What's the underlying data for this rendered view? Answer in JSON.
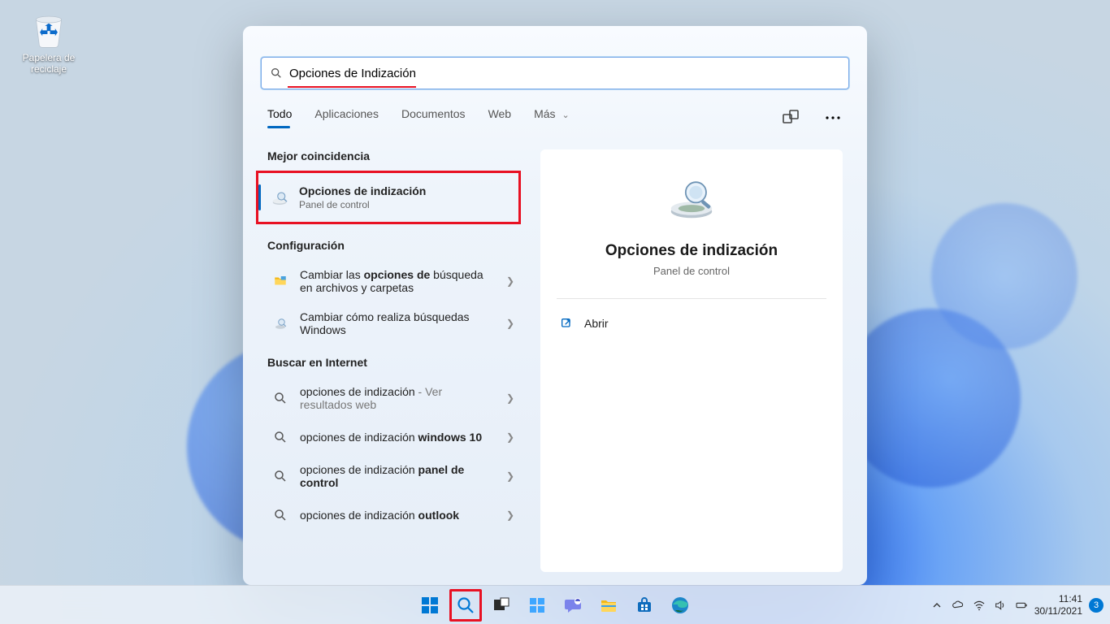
{
  "desktop": {
    "recycle_bin": "Papelera de reciclaje"
  },
  "search": {
    "query": "Opciones de Indización",
    "tabs": {
      "all": "Todo",
      "apps": "Aplicaciones",
      "docs": "Documentos",
      "web": "Web",
      "more": "Más"
    },
    "best_match_label": "Mejor coincidencia",
    "best_match": {
      "title": "Opciones de indización",
      "subtitle": "Panel de control"
    },
    "settings_label": "Configuración",
    "settings_items": [
      {
        "html": "Cambiar las <strong>opciones de</strong> búsqueda en archivos y carpetas"
      },
      {
        "html": "Cambiar cómo realiza búsquedas Windows"
      }
    ],
    "web_label": "Buscar en Internet",
    "web_items": [
      {
        "html": "opciones de indización <span style='color:#777'>- Ver resultados web</span>"
      },
      {
        "html": "opciones de indización <strong>windows 10</strong>"
      },
      {
        "html": "opciones de indización <strong>panel de control</strong>"
      },
      {
        "html": "opciones de indización <strong>outlook</strong>"
      }
    ],
    "preview": {
      "title": "Opciones de indización",
      "subtitle": "Panel de control",
      "open": "Abrir"
    }
  },
  "taskbar": {
    "time": "11:41",
    "date": "30/11/2021",
    "notif_count": "3"
  }
}
